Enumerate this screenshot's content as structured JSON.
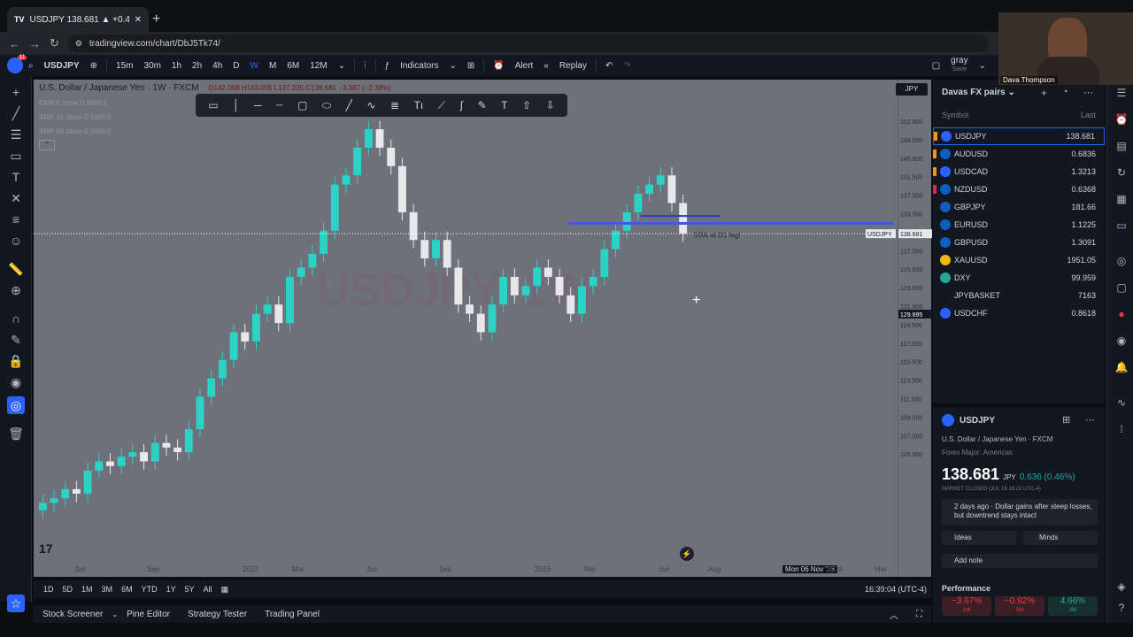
{
  "browser": {
    "tab_title": "USDJPY 138.681 ▲ +0.46% gray",
    "url": "tradingview.com/chart/DbJ5Tk74/"
  },
  "toolbar": {
    "symbol": "USDJPY",
    "intervals": [
      "15m",
      "30m",
      "1h",
      "2h",
      "4h",
      "D",
      "W",
      "M",
      "6M",
      "12M"
    ],
    "active_interval": "W",
    "indicators": "Indicators",
    "alert": "Alert",
    "replay": "Replay",
    "layout_name": "gray",
    "layout_sub": "Save"
  },
  "chart": {
    "legend_title": "U.S. Dollar / Japanese Yen · 1W · FXCM",
    "ohlc": "O142.068 H143.005 L137.235 C138.681 −3.387 (−2.38%)",
    "indicators": [
      "EMA 8 close 0 SMA 5",
      "SMA 16 close 0 SMA 5",
      "SMA 66 close 0 SMA 5"
    ],
    "currency": "JPY",
    "watermark": "USDJPY, 1W",
    "annotation": "50% of D1 leg!",
    "symbol_tag": "USDJPY",
    "last_price_tag": "138.681",
    "crosshair_price": "129.695",
    "price_labels": [
      "152.500",
      "149.500",
      "145.500",
      "141.500",
      "137.500",
      "133.500",
      "129.500",
      "127.500",
      "125.500",
      "123.500",
      "121.500",
      "119.500",
      "117.500",
      "115.500",
      "113.500",
      "111.500",
      "109.500",
      "107.500",
      "105.900"
    ],
    "time_labels": [
      "Jun",
      "Sep",
      "2022",
      "Mar",
      "Jun",
      "Sep",
      "2023",
      "Mar",
      "Jun",
      "Aug",
      "Mon 06 Nov '23",
      "2024",
      "Mar"
    ],
    "colors": {
      "up": "#2ad3c6",
      "down": "#e8e8ea",
      "level": "#3f5bd9",
      "background": "#6e707a"
    }
  },
  "chart_data": {
    "type": "candlestick",
    "series": [
      {
        "name": "USDJPY",
        "close": [
          109.5,
          110,
          111,
          110.5,
          113,
          114,
          113.5,
          114.5,
          115,
          114,
          116,
          115.5,
          115,
          117.5,
          121,
          123,
          125,
          128,
          127,
          130,
          131,
          129,
          134,
          135,
          136.5,
          139,
          144,
          145,
          148,
          150,
          148,
          146,
          141,
          138,
          136,
          138,
          135,
          131,
          130,
          128,
          131,
          134,
          132,
          133,
          135,
          134,
          132,
          130,
          133,
          134,
          137,
          139,
          141,
          143,
          144,
          145,
          142,
          138.681
        ]
      }
    ],
    "ylim": [
      105.9,
      152.5
    ],
    "horizontal_levels": [
      138.68,
      139.8,
      140.6
    ]
  },
  "range_bar": {
    "ranges": [
      "1D",
      "5D",
      "1M",
      "3M",
      "6M",
      "YTD",
      "1Y",
      "5Y",
      "All"
    ],
    "clock": "16:39:04 (UTC-4)"
  },
  "panels": [
    "Stock Screener",
    "Pine Editor",
    "Strategy Tester",
    "Trading Panel"
  ],
  "watchlist": {
    "title": "Davas FX pairs",
    "col_symbol": "Symbol",
    "col_last": "Last",
    "rows": [
      {
        "symbol": "USDJPY",
        "last": "138.681",
        "flag": "#f7931a",
        "icon": "#2962ff"
      },
      {
        "symbol": "AUDUSD",
        "last": "0.6836",
        "flag": "#f7931a",
        "icon": "#0b5fbf"
      },
      {
        "symbol": "USDCAD",
        "last": "1.3213",
        "flag": "#f7931a",
        "icon": "#2962ff"
      },
      {
        "symbol": "NZDUSD",
        "last": "0.6368",
        "flag": "#e91e63",
        "icon": "#0b5fbf"
      },
      {
        "symbol": "GBPJPY",
        "last": "181.66",
        "flag": "",
        "icon": "#0b5fbf"
      },
      {
        "symbol": "EURUSD",
        "last": "1.1225",
        "flag": "",
        "icon": "#0b5fbf"
      },
      {
        "symbol": "GBPUSD",
        "last": "1.3091",
        "flag": "",
        "icon": "#0b5fbf"
      },
      {
        "symbol": "XAUUSD",
        "last": "1951.05",
        "flag": "",
        "icon": "#f0b90b"
      },
      {
        "symbol": "DXY",
        "last": "99.959",
        "flag": "",
        "icon": "#26a69a"
      },
      {
        "symbol": "JPYBASKET",
        "last": "7163",
        "flag": "",
        "icon": "#131722"
      },
      {
        "symbol": "USDCHF",
        "last": "0.8618",
        "flag": "",
        "icon": "#2962ff"
      }
    ]
  },
  "details": {
    "symbol": "USDJPY",
    "full_name": "U.S. Dollar / Japanese Yen · FXCM",
    "category": "Forex Major: Americas",
    "price": "138.681",
    "currency": "JPY",
    "change": "0.636 (0.46%)",
    "status": "MARKET CLOSED (JUL 16 16:22 UTC-4)",
    "news": "2 days ago · Dollar gains after steep losses, but downtrend stays intact",
    "ideas": "Ideas",
    "minds": "Minds",
    "add_note": "Add note",
    "performance": "Performance",
    "perf": [
      {
        "v": "−3.67%",
        "p": "1W"
      },
      {
        "v": "−0.92%",
        "p": "1M"
      },
      {
        "v": "4.66%",
        "p": "3M"
      }
    ]
  },
  "webcam": {
    "name": "Dava Thompson"
  }
}
